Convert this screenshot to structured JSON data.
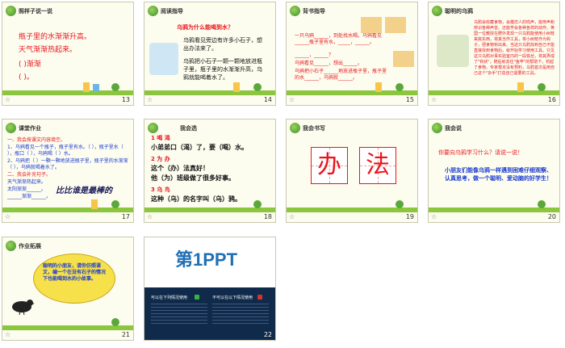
{
  "slides": [
    {
      "num": "13",
      "title": "照样子说一说",
      "lines": [
        "瓶子里的水渐渐升高。",
        "天气渐渐热起来。",
        "(        )渐渐",
        "(        )。"
      ]
    },
    {
      "num": "14",
      "title": "阅读指导",
      "question": "乌鸦为什么能喝到水？",
      "para1": "乌鸦看见旁边有许多小石子，想出办法来了。",
      "para2": "乌鸦把小石子一颗一颗地放进瓶子里，瓶子里的水渐渐升高，乌鸦就能喝着水了。"
    },
    {
      "num": "15",
      "title": "背书指导",
      "lines": [
        "一只乌鸦______，到处找水喝。乌鸦看见______瓶子里有水，_____，______。",
        "______，______？",
        "乌鸦看见______，想出______。",
        "乌鸦把小石子______地放进瓶子里，瓶子里的水______，乌鸦就______。"
      ]
    },
    {
      "num": "16",
      "title": "聪明的乌鸦",
      "para": "乌鸦会收藏食物，会模仿人的鸣声，能辨声和辨识各种声音。还能学会各种各样的动作。英国一位教授在野外发现一只乌鸦能使用小树枝来挑东西，将其当作工具，将小树枝作为钩子，把食物钩出来。当这只乌鸦找到自己不能直接找到食物后，就开始学习使用工具。只见这只乌鸦对事实验室内的一段铁丝，将其弄成了\"钩状\"，随后就去往\"鱼竿\"的帮助下，钓起了食物。专家根本没有预料，乌鸦首次是用自己这个\"杂手\"打造自己需要的工具。"
    },
    {
      "num": "17",
      "title": "课堂作业",
      "lines": [
        "一、我会按课文内容填空。",
        "1、乌鸦看见一个瓶子，瓶子里有水。（  ），瓶子里水（  ），瓶口（  ），乌鸦喝（  ）水。",
        "2、乌鸦把（  ）一颗一颗地放进瓶子里，瓶子里的水渐渐（  ），乌鸦就喝着水了。",
        "二、我会补充句子。",
        "天气渐渐热起来。",
        "太阳渐渐______。",
        "______渐渐______。"
      ],
      "handwriting": "比比谁是最棒的"
    },
    {
      "num": "18",
      "title": "我会选",
      "q1": "1  喝  渴",
      "a1": "小弟弟口（渴）了，要（喝）水。",
      "q2": "2  为  办",
      "a2a": "这个（办）法真好！",
      "a2b": "他（为）班级做了很多好事。",
      "q3": "3  乌  鸟",
      "a3": "这种（乌）的名字叫（乌）鸦。"
    },
    {
      "num": "19",
      "title": "我会书写",
      "chars": [
        "办",
        "法"
      ]
    },
    {
      "num": "20",
      "title": "我会说",
      "question": "你要向乌鸦学习什么？请说一说！",
      "answer": "小朋友们能像乌鸦一样遇到困难仔细观察、认真思考，做一个聪明、爱动脑的好学生！"
    },
    {
      "num": "21",
      "title": "作业拓展",
      "bubble": "聪明的小朋友，请你仿照课文，编一个在没有石子的情况下也能喝到水的小故事。"
    },
    {
      "num": "22",
      "brand": "第1PPT",
      "left_caption": "可以在下列情况使用",
      "right_caption": "不可以在以下情况使用"
    }
  ],
  "colors": {
    "slide_bg": "#fdfdef",
    "accent_red": "#e8161e",
    "accent_blue": "#1b3bd2"
  }
}
